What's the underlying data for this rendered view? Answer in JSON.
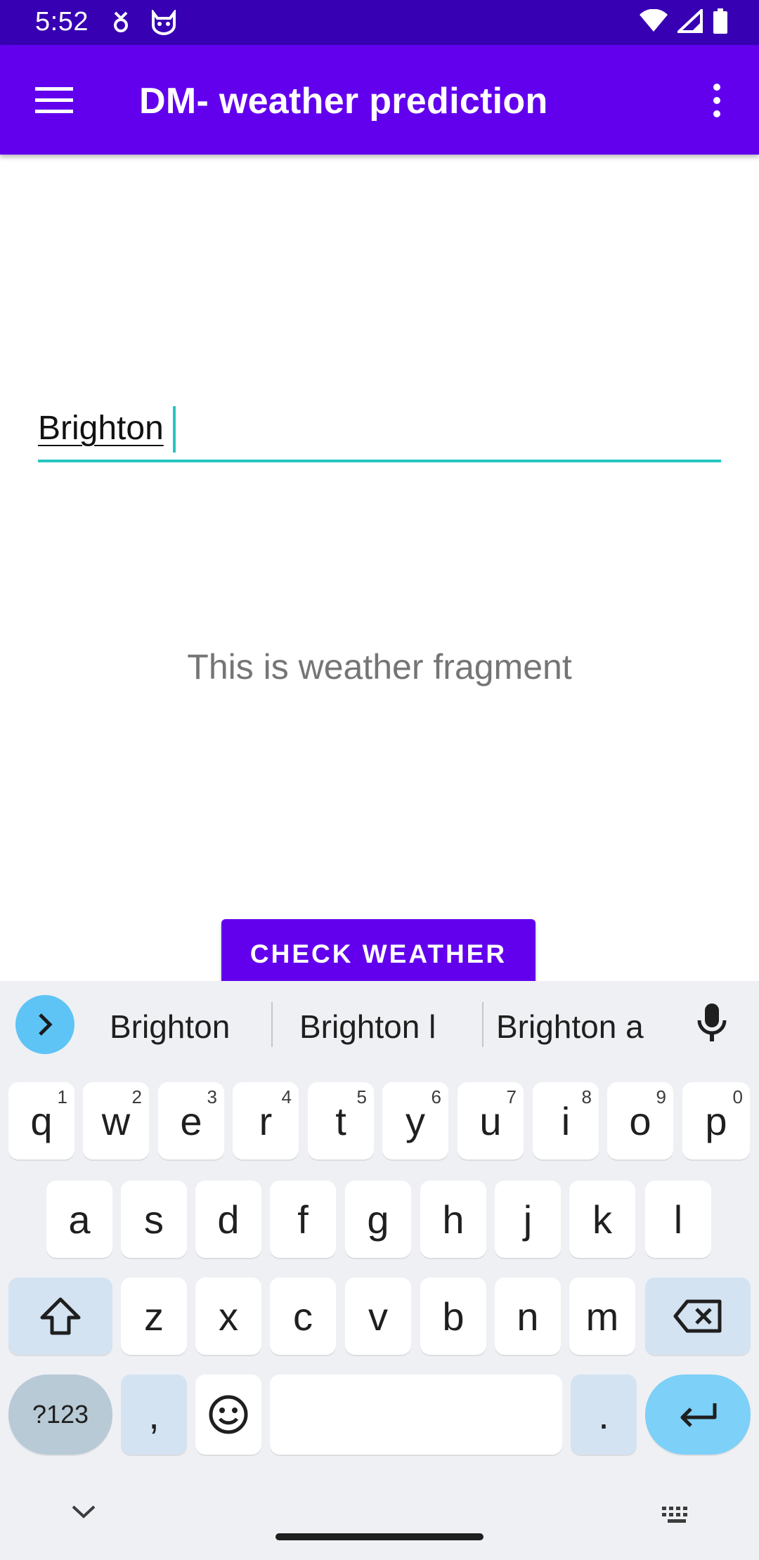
{
  "status_bar": {
    "time": "5:52",
    "icons": [
      "data-saver-icon",
      "cat-face-icon",
      "wifi-icon",
      "signal-icon",
      "battery-icon"
    ]
  },
  "app_bar": {
    "title": "DM- weather prediction",
    "menu_icon": "hamburger-menu-icon",
    "overflow_icon": "more-vert-icon"
  },
  "content": {
    "city_input_value": "Brighton",
    "fragment_text": "This is weather fragment",
    "check_button_label": "CHECK WEATHER"
  },
  "keyboard": {
    "suggestions": [
      "Brighton",
      "Brighton l",
      "Brighton a"
    ],
    "row1": [
      {
        "k": "q",
        "s": "1"
      },
      {
        "k": "w",
        "s": "2"
      },
      {
        "k": "e",
        "s": "3"
      },
      {
        "k": "r",
        "s": "4"
      },
      {
        "k": "t",
        "s": "5"
      },
      {
        "k": "y",
        "s": "6"
      },
      {
        "k": "u",
        "s": "7"
      },
      {
        "k": "i",
        "s": "8"
      },
      {
        "k": "o",
        "s": "9"
      },
      {
        "k": "p",
        "s": "0"
      }
    ],
    "row2": [
      "a",
      "s",
      "d",
      "f",
      "g",
      "h",
      "j",
      "k",
      "l"
    ],
    "row3": [
      "z",
      "x",
      "c",
      "v",
      "b",
      "n",
      "m"
    ],
    "symbols_label": "?123",
    "comma_label": ",",
    "period_label": "."
  },
  "colors": {
    "status_bar": "#3700b3",
    "primary": "#6200ee",
    "accent": "#26c6c0",
    "keyboard_bg": "#eff0f4"
  }
}
